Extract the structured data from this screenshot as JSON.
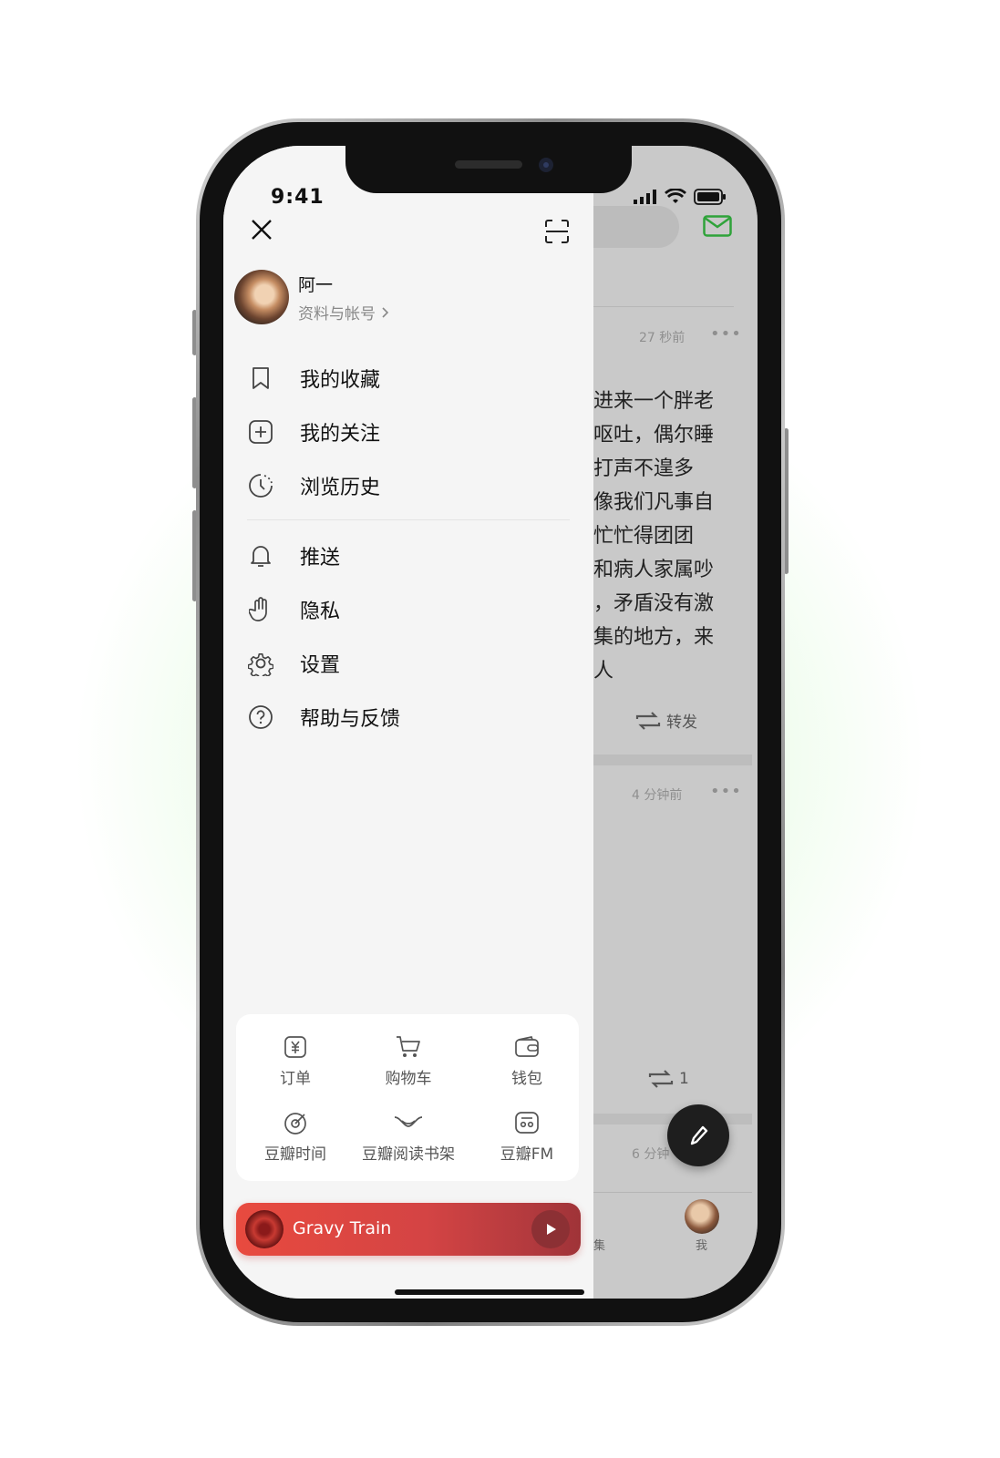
{
  "status": {
    "time": "9:41"
  },
  "drawer": {
    "user": {
      "name": "阿一",
      "profile_link": "资料与帐号"
    },
    "menu": [
      {
        "label": "我的收藏",
        "icon": "bookmark-icon"
      },
      {
        "label": "我的关注",
        "icon": "plus-square-icon"
      },
      {
        "label": "浏览历史",
        "icon": "history-icon"
      },
      {
        "label": "推送",
        "icon": "bell-icon"
      },
      {
        "label": "隐私",
        "icon": "hand-icon"
      },
      {
        "label": "设置",
        "icon": "gear-icon"
      },
      {
        "label": "帮助与反馈",
        "icon": "help-circle-icon"
      }
    ],
    "services": [
      {
        "label": "订单",
        "icon": "order-icon"
      },
      {
        "label": "购物车",
        "icon": "cart-icon"
      },
      {
        "label": "钱包",
        "icon": "wallet-icon"
      },
      {
        "label": "豆瓣时间",
        "icon": "douban-time-icon"
      },
      {
        "label": "豆瓣阅读书架",
        "icon": "bookshelf-icon"
      },
      {
        "label": "豆瓣FM",
        "icon": "radio-icon"
      }
    ],
    "player": {
      "title": "Gravy Train"
    }
  },
  "feed": {
    "post1_time": "27 秒前",
    "post1_text": "进来一个胖老\n呕吐，偶尔睡\n打声不遑多\n像我们凡事自\n忙忙得团团\n和病人家属吵\n，矛盾没有激\n集的地方，来\n人",
    "post1_repost": "转发",
    "post2_time": "4 分钟前",
    "post2_repost_count": "1",
    "post3_time": "6 分钟",
    "tab_ji": "集",
    "tab_me": "我"
  },
  "colors": {
    "accent_green": "#2fa33a",
    "player_red": "#e84a3f"
  }
}
